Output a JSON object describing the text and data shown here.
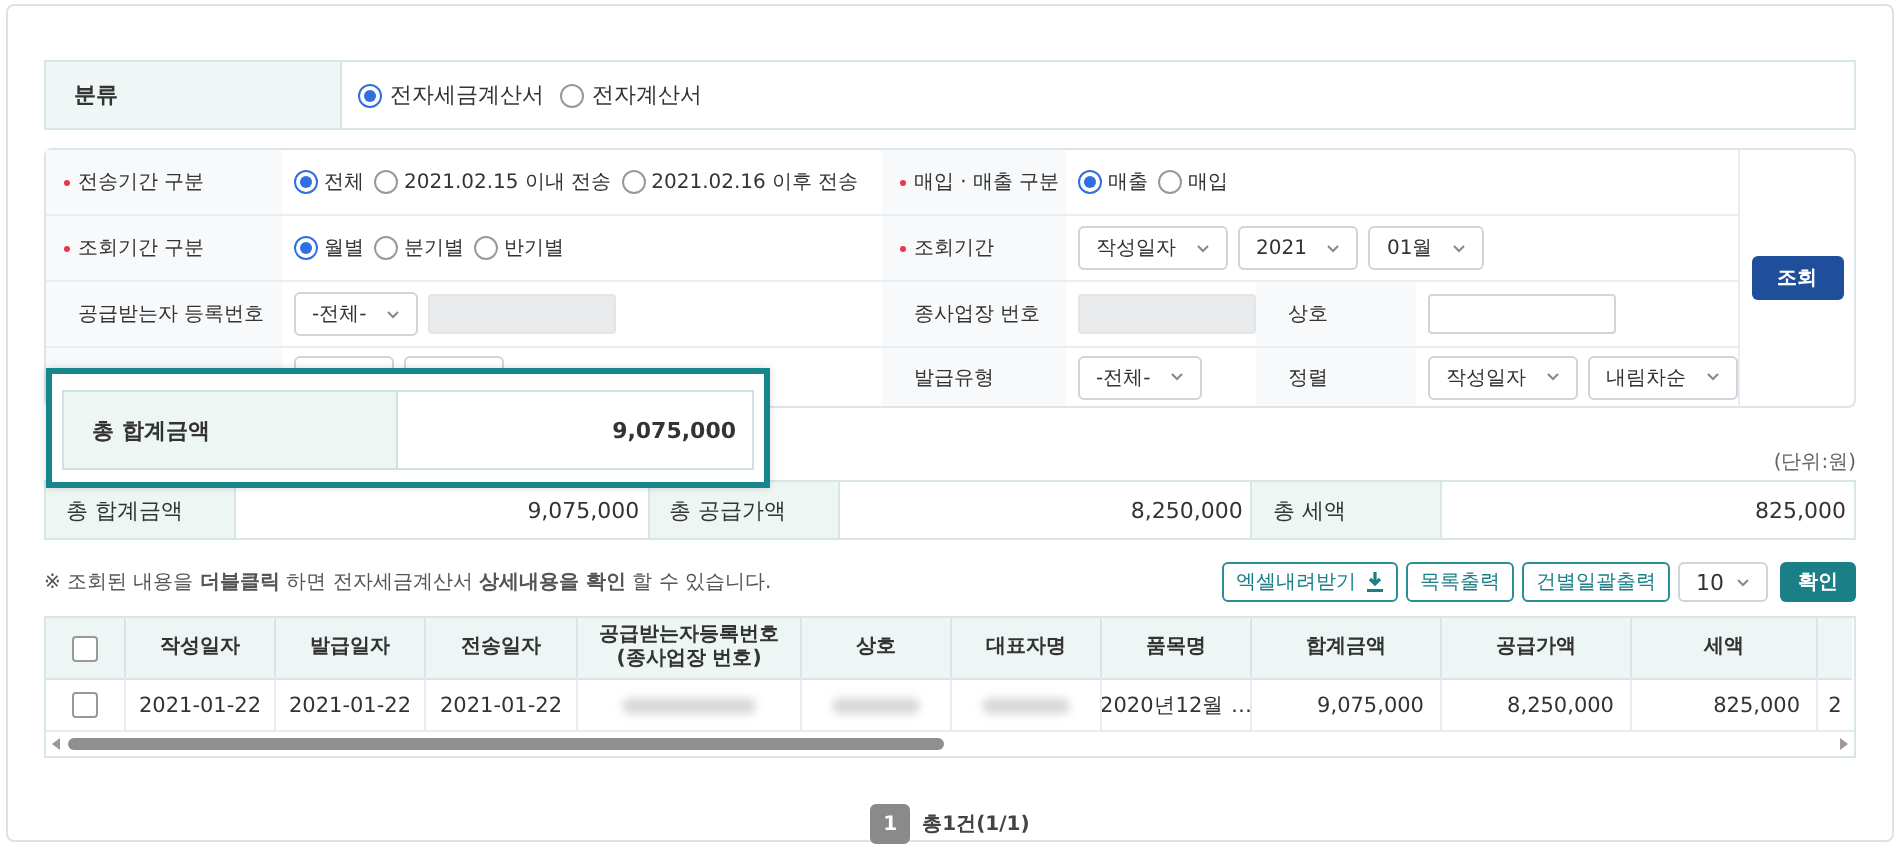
{
  "classification": {
    "label": "분류",
    "options": [
      {
        "label": "전자세금계산서",
        "selected": true
      },
      {
        "label": "전자계산서",
        "selected": false
      }
    ]
  },
  "search_form": {
    "rows": [
      {
        "cells": [
          {
            "kind": "label",
            "text": "전송기간 구분",
            "required": true
          },
          {
            "kind": "controls",
            "controls": [
              {
                "kind": "radio",
                "label": "전체",
                "selected": true
              },
              {
                "kind": "radio",
                "label": "2021.02.15 이내 전송",
                "selected": false
              },
              {
                "kind": "radio",
                "label": "2021.02.16 이후 전송",
                "selected": false
              }
            ]
          },
          {
            "kind": "label",
            "text": "매입 · 매출 구분",
            "required": true
          },
          {
            "kind": "controls",
            "controls": [
              {
                "kind": "radio",
                "label": "매출",
                "selected": true
              },
              {
                "kind": "radio",
                "label": "매입",
                "selected": false
              }
            ]
          }
        ]
      },
      {
        "cells": [
          {
            "kind": "label",
            "text": "조회기간 구분",
            "required": true
          },
          {
            "kind": "controls",
            "controls": [
              {
                "kind": "radio",
                "label": "월별",
                "selected": true
              },
              {
                "kind": "radio",
                "label": "분기별",
                "selected": false
              },
              {
                "kind": "radio",
                "label": "반기별",
                "selected": false
              }
            ]
          },
          {
            "kind": "label",
            "text": "조회기간",
            "required": true
          },
          {
            "kind": "controls",
            "controls": [
              {
                "kind": "select",
                "value": "작성일자"
              },
              {
                "kind": "select",
                "value": "2021"
              },
              {
                "kind": "select",
                "value": "01월"
              }
            ]
          }
        ]
      },
      {
        "cells": [
          {
            "kind": "label",
            "text": "공급받는자 등록번호"
          },
          {
            "kind": "controls",
            "controls": [
              {
                "kind": "select",
                "value": "-전체-"
              },
              {
                "kind": "input",
                "disabled": true
              }
            ]
          },
          {
            "kind": "label",
            "text": "종사업장 번호"
          },
          {
            "kind": "controls",
            "controls": [
              {
                "kind": "input",
                "disabled": true
              }
            ]
          },
          {
            "kind": "label",
            "text": "상호"
          },
          {
            "kind": "controls",
            "controls": [
              {
                "kind": "input",
                "disabled": false
              }
            ]
          }
        ]
      },
      {
        "cells": [
          {
            "kind": "label"
          },
          {
            "kind": "controls",
            "controls": [
              {
                "kind": "select"
              },
              {
                "kind": "select"
              }
            ]
          },
          {
            "kind": "label",
            "text": "발급유형"
          },
          {
            "kind": "controls",
            "controls": [
              {
                "kind": "select",
                "value": "-전체-"
              }
            ]
          },
          {
            "kind": "label",
            "text": "정렬"
          },
          {
            "kind": "controls",
            "controls": [
              {
                "kind": "select",
                "value": "작성일자"
              },
              {
                "kind": "select",
                "value": "내림차순"
              }
            ]
          }
        ]
      }
    ],
    "search_button": "조회"
  },
  "callout": {
    "label": "총 합계금액",
    "value": "9,075,000"
  },
  "summary": {
    "unit": "(단위:원)",
    "items": [
      {
        "label": "총 합계금액",
        "value": "9,075,000"
      },
      {
        "label": "총 공급가액",
        "value": "8,250,000"
      },
      {
        "label": "총 세액",
        "value": "825,000"
      }
    ]
  },
  "notice": "※ 조회된 내용을 **더블클릭** 하면 전자세금계산서 **상세내용을 확인** 할 수 있습니다.",
  "toolbar": {
    "buttons": [
      {
        "label": "엑셀내려받기",
        "kind": "download"
      },
      {
        "label": "목록출력",
        "kind": "plain"
      },
      {
        "label": "건별일괄출력",
        "kind": "plain"
      }
    ],
    "page_size": "10",
    "confirm": "확인"
  },
  "table": {
    "select_all_checked": false,
    "columns": [
      "작성일자",
      "발급일자",
      "전송일자",
      "공급받는자등록번호\n(종사업장 번호)",
      "상호",
      "대표자명",
      "품목명",
      "합계금액",
      "공급가액",
      "세액"
    ],
    "rows": [
      {
        "checked": false,
        "cells": [
          {
            "kind": "text",
            "text": "2021-01-22"
          },
          {
            "kind": "text",
            "text": "2021-01-22"
          },
          {
            "kind": "text",
            "text": "2021-01-22"
          },
          {
            "kind": "blurred"
          },
          {
            "kind": "blurred"
          },
          {
            "kind": "blurred"
          },
          {
            "kind": "text",
            "text": "2020년12월 …"
          },
          {
            "kind": "number",
            "text": "9,075,000"
          },
          {
            "kind": "number",
            "text": "8,250,000"
          },
          {
            "kind": "number",
            "text": "825,000"
          },
          {
            "kind": "text",
            "text": "2"
          }
        ]
      }
    ]
  },
  "pagination": {
    "pages": [
      {
        "label": "1",
        "selected": true
      }
    ],
    "total": "총1건(1/1)"
  }
}
